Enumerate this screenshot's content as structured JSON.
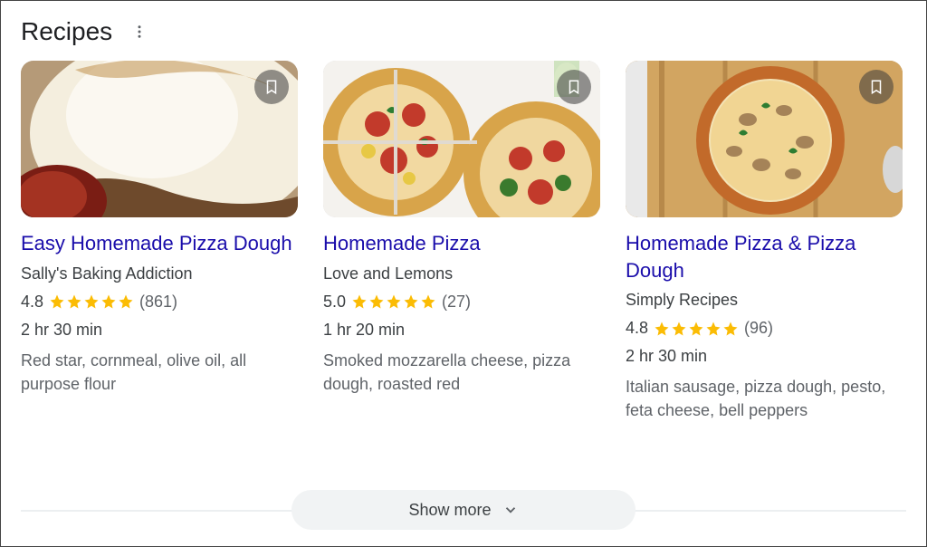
{
  "section_title": "Recipes",
  "show_more_label": "Show more",
  "cards": [
    {
      "title": "Easy Homemade Pizza Dough",
      "source": "Sally's Baking Addiction",
      "rating": "4.8",
      "reviews": "(861)",
      "duration": "2 hr 30 min",
      "ingredients": "Red star, cornmeal, olive oil, all purpose flour"
    },
    {
      "title": "Homemade Pizza",
      "source": "Love and Lemons",
      "rating": "5.0",
      "reviews": "(27)",
      "duration": "1 hr 20 min",
      "ingredients": "Smoked mozzarella cheese, pizza dough, roasted red"
    },
    {
      "title": "Homemade Pizza & Pizza Dough",
      "source": "Simply Recipes",
      "rating": "4.8",
      "reviews": "(96)",
      "duration": "2 hr 30 min",
      "ingredients": "Italian sausage, pizza dough, pesto, feta cheese, bell peppers"
    }
  ]
}
